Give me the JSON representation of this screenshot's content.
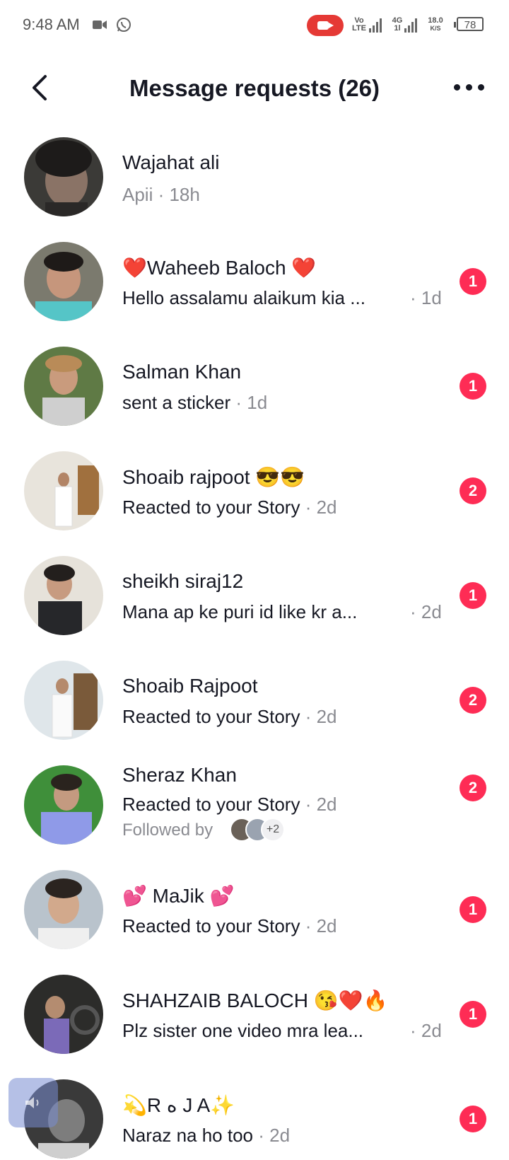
{
  "status_bar": {
    "time": "9:48 AM",
    "network_type": "4G",
    "network_sub": "1l",
    "volte": "Vo",
    "volte_sub": "LTE",
    "speed_value": "18.0",
    "speed_unit": "K/S",
    "battery": "78",
    "icons": [
      "video-camera-icon",
      "whatsapp-icon",
      "screen-record-icon",
      "signal-icon",
      "battery-icon"
    ]
  },
  "header": {
    "title": "Message requests (26)",
    "back_icon": "back-arrow-icon",
    "more_icon": "more-options-icon"
  },
  "requests": [
    {
      "name": "Wajahat ali",
      "preview": "Apii",
      "time": "· 18h",
      "badge": "",
      "read": true
    },
    {
      "name_prefix": "❤️",
      "name": "Waheeb Baloch",
      "name_suffix": "❤️",
      "preview": "Hello assalamu alaikum kia ...",
      "time": "· 1d",
      "badge": "1"
    },
    {
      "name": "Salman Khan",
      "preview": "sent a sticker",
      "time": "· 1d",
      "badge": "1"
    },
    {
      "name": "Shoaib rajpoot",
      "name_suffix": "😎😎",
      "preview": "Reacted to your Story",
      "time": "· 2d",
      "badge": "2"
    },
    {
      "name": "sheikh siraj12",
      "preview": "Mana ap ke puri id like kr a...",
      "time": "· 2d",
      "badge": "1"
    },
    {
      "name": "Shoaib Rajpoot",
      "preview": "Reacted to your Story",
      "time": "· 2d",
      "badge": "2"
    },
    {
      "name": "Sheraz Khan",
      "preview": "Reacted to your Story",
      "time": "· 2d",
      "badge": "2",
      "followed_by": "Followed by",
      "followed_more": "+2"
    },
    {
      "name_prefix": "💕",
      "name": "MaJik",
      "name_suffix": "💕",
      "preview": "Reacted to your Story",
      "time": "· 2d",
      "badge": "1"
    },
    {
      "name": "SHAHZAIB BALOCH",
      "name_suffix": "😘❤️🔥",
      "preview": "Plz sister one video mra lea...",
      "time": "· 2d",
      "badge": "1"
    },
    {
      "name_prefix": "💫",
      "name": "R   ه   J   A",
      "name_suffix": "✨",
      "preview": "Naraz na ho too",
      "time": "· 2d",
      "badge": "1"
    }
  ],
  "floating_button_icon": "speaker-icon"
}
